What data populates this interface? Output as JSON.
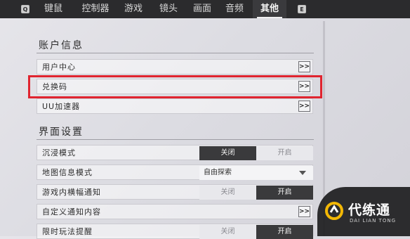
{
  "tabs": [
    {
      "label": "键鼠"
    },
    {
      "label": "控制器"
    },
    {
      "label": "游戏"
    },
    {
      "label": "镜头"
    },
    {
      "label": "画面"
    },
    {
      "label": "音频"
    },
    {
      "label": "其他",
      "active": true
    }
  ],
  "key_hints": {
    "left": "Q",
    "right": "E"
  },
  "account": {
    "title": "账户信息",
    "rows": [
      {
        "label": "用户中心"
      },
      {
        "label": "兑换码"
      },
      {
        "label": "UU加速器"
      }
    ],
    "arrow_glyph": ">>"
  },
  "interface": {
    "title": "界面设置",
    "immersive": {
      "label": "沉浸模式",
      "off": "关闭",
      "on": "开启",
      "selected": "关闭"
    },
    "map_info": {
      "label": "地图信息模式",
      "value": "自由探索"
    },
    "banner": {
      "label": "游戏内横幅通知",
      "off": "关闭",
      "on": "开启",
      "selected": "开启"
    },
    "custom_notice": {
      "label": "自定义通知内容"
    },
    "limited": {
      "label": "限时玩法提醒",
      "off": "关闭",
      "on": "开启",
      "selected": "开启"
    }
  },
  "watermark": {
    "title": "代练通",
    "subtitle": "DAI LIAN TONG"
  },
  "colors": {
    "highlight": "#e0242f",
    "tabbar": "#2b2b2d",
    "toggle_on": "#3a3a3c"
  }
}
